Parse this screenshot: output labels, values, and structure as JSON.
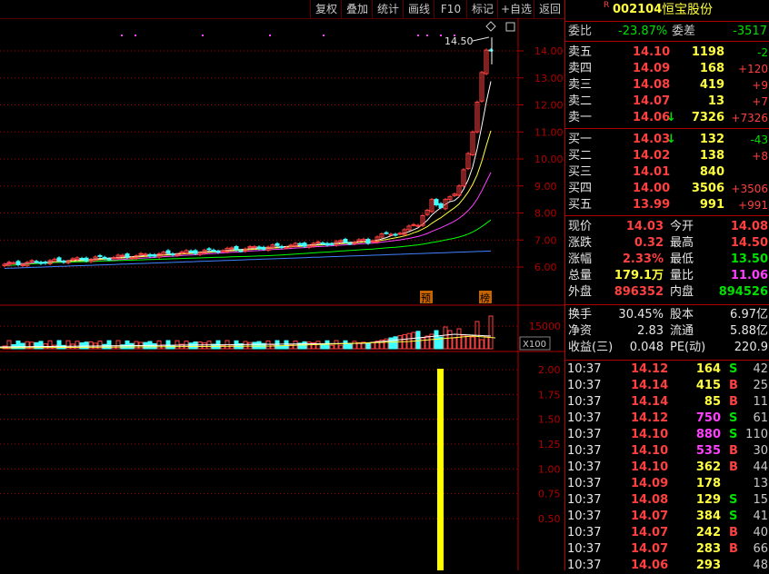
{
  "toolbar": {
    "buttons": [
      "复权",
      "叠加",
      "统计",
      "画线",
      "F10",
      "标记",
      "+自选",
      "返回"
    ]
  },
  "stock": {
    "badge": "R",
    "code": "002104",
    "name": "恒宝股份"
  },
  "price_axis": {
    "ticks": [
      "14.00",
      "13.00",
      "12.00",
      "11.00",
      "10.00",
      "9.00",
      "8.00",
      "7.00",
      "6.00"
    ],
    "high_label": "14.50"
  },
  "volume_axis": {
    "tick": "15000",
    "unit": "X100"
  },
  "indicator_axis": {
    "ticks": [
      "2.00",
      "1.75",
      "1.50",
      "1.25",
      "1.00",
      "0.75",
      "0.50"
    ]
  },
  "markers": {
    "pre": "预",
    "bang": "榜"
  },
  "order_ratio": {
    "label": "委比",
    "value": "-23.87%",
    "diff_label": "委差",
    "diff_value": "-3517"
  },
  "asks": [
    {
      "label": "卖五",
      "price": "14.10",
      "vol": "1198",
      "chg": "-2"
    },
    {
      "label": "卖四",
      "price": "14.09",
      "vol": "168",
      "chg": "+120"
    },
    {
      "label": "卖三",
      "price": "14.08",
      "vol": "419",
      "chg": "+9"
    },
    {
      "label": "卖二",
      "price": "14.07",
      "vol": "13",
      "chg": "+7"
    },
    {
      "label": "卖一",
      "price": "14.06",
      "vol": "7326",
      "chg": "+7326",
      "arrow": "↓"
    }
  ],
  "bids": [
    {
      "label": "买一",
      "price": "14.03",
      "vol": "132",
      "chg": "-43",
      "arrow": "↓"
    },
    {
      "label": "买二",
      "price": "14.02",
      "vol": "138",
      "chg": "+8"
    },
    {
      "label": "买三",
      "price": "14.01",
      "vol": "840",
      "chg": ""
    },
    {
      "label": "买四",
      "price": "14.00",
      "vol": "3506",
      "chg": "+3506"
    },
    {
      "label": "买五",
      "price": "13.99",
      "vol": "991",
      "chg": "+991"
    }
  ],
  "quote": [
    {
      "l1": "现价",
      "v1": "14.03",
      "l2": "今开",
      "v2": "14.08"
    },
    {
      "l1": "涨跌",
      "v1": "0.32",
      "l2": "最高",
      "v2": "14.50"
    },
    {
      "l1": "涨幅",
      "v1": "2.33%",
      "l2": "最低",
      "v2": "13.50"
    },
    {
      "l1": "总量",
      "v1": "179.1万",
      "l2": "量比",
      "v2": "11.06"
    },
    {
      "l1": "外盘",
      "v1": "896352",
      "l2": "内盘",
      "v2": "894526"
    }
  ],
  "fundamentals": [
    {
      "l1": "换手",
      "v1": "30.45%",
      "l2": "股本",
      "v2": "6.97亿"
    },
    {
      "l1": "净资",
      "v1": "2.83",
      "l2": "流通",
      "v2": "5.88亿"
    },
    {
      "l1": "收益(三)",
      "v1": "0.048",
      "l2": "PE(动)",
      "v2": "220.9"
    }
  ],
  "ticks": [
    {
      "time": "10:37",
      "price": "14.12",
      "vol": "164",
      "side": "S",
      "n": "42"
    },
    {
      "time": "10:37",
      "price": "14.14",
      "vol": "415",
      "side": "B",
      "n": "25"
    },
    {
      "time": "10:37",
      "price": "14.14",
      "vol": "85",
      "side": "B",
      "n": "11"
    },
    {
      "time": "10:37",
      "price": "14.12",
      "vol": "750",
      "side": "S",
      "n": "61"
    },
    {
      "time": "10:37",
      "price": "14.10",
      "vol": "880",
      "side": "S",
      "n": "110"
    },
    {
      "time": "10:37",
      "price": "14.10",
      "vol": "535",
      "side": "B",
      "n": "30"
    },
    {
      "time": "10:37",
      "price": "14.10",
      "vol": "362",
      "side": "B",
      "n": "44"
    },
    {
      "time": "10:37",
      "price": "14.09",
      "vol": "178",
      "side": "",
      "n": "13"
    },
    {
      "time": "10:37",
      "price": "14.08",
      "vol": "129",
      "side": "S",
      "n": "15"
    },
    {
      "time": "10:37",
      "price": "14.07",
      "vol": "384",
      "side": "S",
      "n": "41"
    },
    {
      "time": "10:37",
      "price": "14.07",
      "vol": "242",
      "side": "B",
      "n": "40"
    },
    {
      "time": "10:37",
      "price": "14.07",
      "vol": "283",
      "side": "B",
      "n": "66"
    },
    {
      "time": "10:37",
      "price": "14.06",
      "vol": "293",
      "side": "",
      "n": "48"
    }
  ],
  "colors": {
    "up": "#ff4040",
    "down": "#00e000",
    "flat": "#c8c8c8",
    "grid": "#b00000"
  }
}
